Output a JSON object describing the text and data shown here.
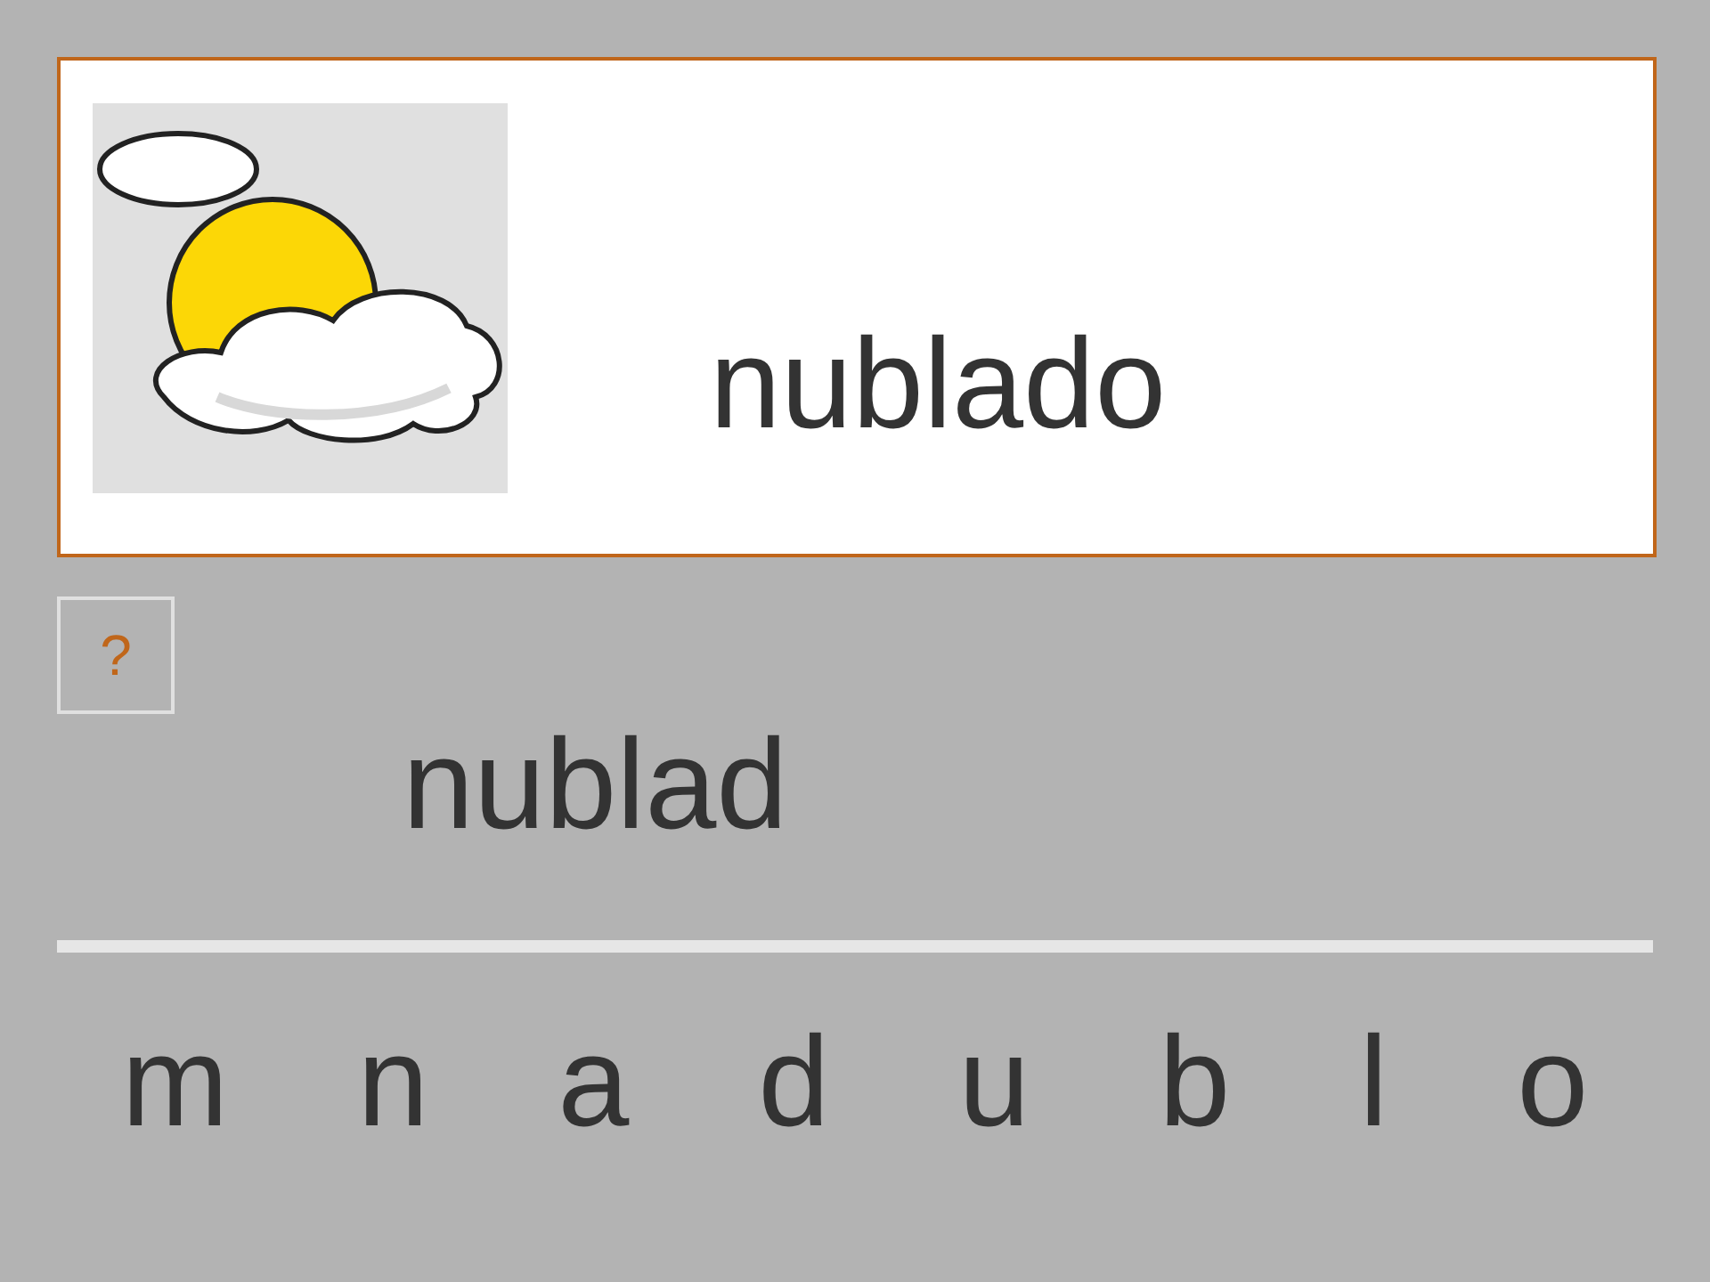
{
  "card": {
    "word": "nublado"
  },
  "hint_button": {
    "label": "?"
  },
  "answer": {
    "text": "nublad"
  },
  "letters": [
    "m",
    "n",
    "a",
    "d",
    "u",
    "b",
    "l",
    "o"
  ]
}
